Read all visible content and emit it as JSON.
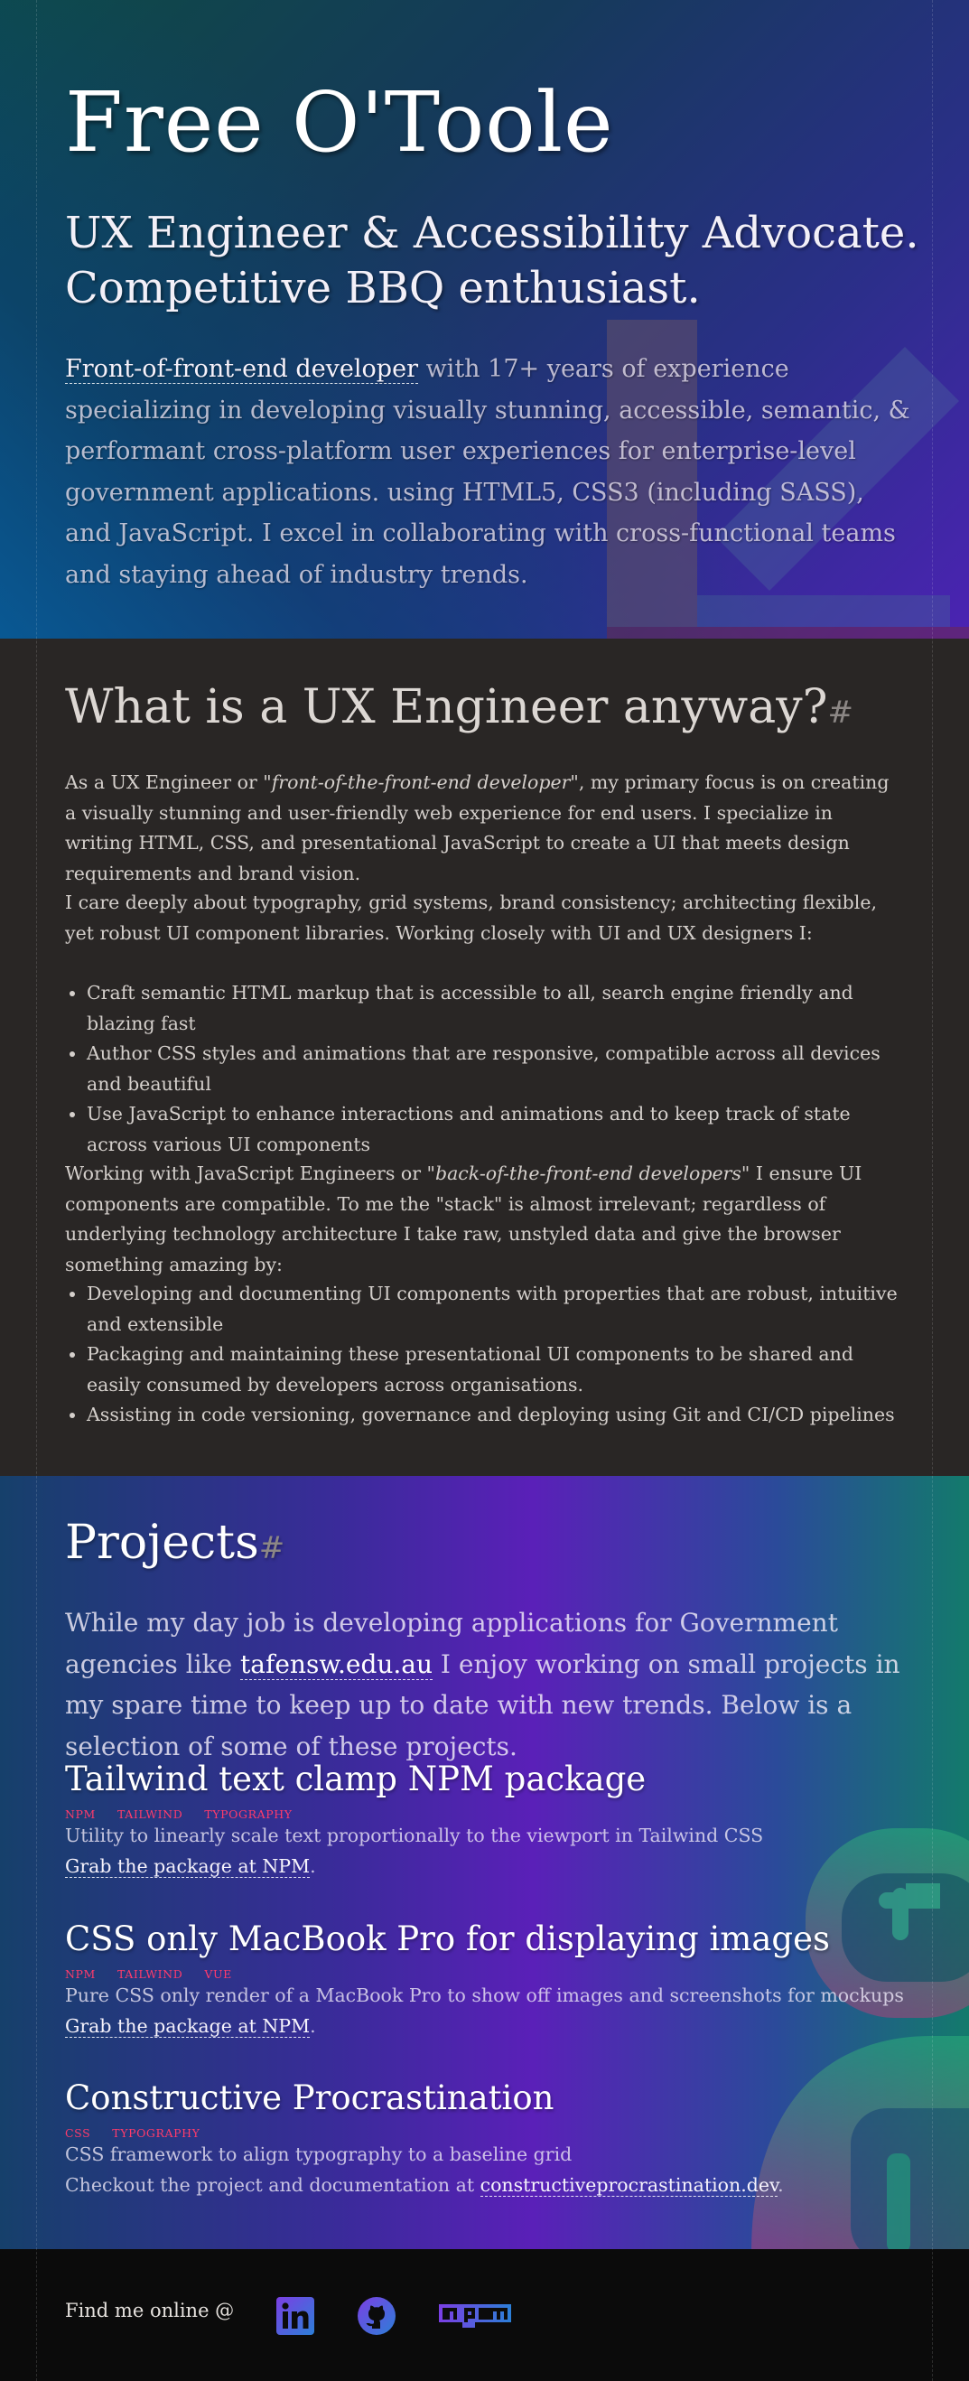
{
  "hero": {
    "name": "Free O'Toole",
    "tagline_line1": "UX Engineer & Accessibility Advocate.",
    "tagline_line2": "Competitive BBQ enthusiast.",
    "intro_link": "Front-of-front-end developer",
    "intro_text": " with 17+ years of experience specializing in developing visually stunning, accessible, semantic, & performant cross-platform user experiences for enterprise-level government applications. using HTML5, CSS3 (including SASS), and JavaScript. I excel in collaborating with cross-functional teams and staying ahead of industry trends."
  },
  "about": {
    "heading": "What is a UX Engineer anyway?",
    "hash": "#",
    "p1_before": "As a UX Engineer or ",
    "p1_em": "\"front-of-the-front-end developer\"",
    "p1_after": ", my primary focus is on creating a visually stunning and user-friendly web experience for end users. I specialize in writing HTML, CSS, and presentational JavaScript to create a UI that meets design requirements and brand vision.",
    "p2": "I care deeply about typography, grid systems, brand consistency; architecting flexible, yet robust UI component libraries. Working closely with UI and UX designers I:",
    "list1": [
      "Craft semantic HTML markup that is accessible to all, search engine friendly and blazing fast",
      "Author CSS styles and animations that are responsive, compatible across all devices and beautiful",
      "Use JavaScript to enhance interactions and animations and to keep track of state across various UI components"
    ],
    "p3_before": "Working with JavaScript Engineers or ",
    "p3_em": "\"back-of-the-front-end developers\"",
    "p3_after": " I ensure UI components are compatible. To me the \"stack\" is almost irrelevant; regardless of underlying technology architecture I take raw, unstyled data and give the browser something amazing by:",
    "list2": [
      "Developing and documenting UI components with properties that are robust, intuitive and extensible",
      "Packaging and maintaining these presentational UI components to be shared and easily consumed by developers across organisations.",
      "Assisting in code versioning, governance and deploying using Git and CI/CD pipelines"
    ]
  },
  "projects": {
    "heading": "Projects",
    "hash": "#",
    "intro_before": "While my day job is developing applications for Government agencies like ",
    "intro_link": "tafensw.edu.au",
    "intro_after": " I enjoy working on small projects in my spare time to keep up to date with new trends. Below is a selection of some of these projects.",
    "items": [
      {
        "title": "Tailwind text clamp NPM package",
        "tags": [
          "NPM",
          "TAILWIND",
          "TYPOGRAPHY"
        ],
        "desc": "Utility to linearly scale text proportionally to the viewport in Tailwind CSS",
        "link_before": "",
        "link": "Grab the package at NPM",
        "link_after": "."
      },
      {
        "title": "CSS only MacBook Pro for displaying images",
        "tags": [
          "NPM",
          "TAILWIND",
          "VUE"
        ],
        "desc": "Pure CSS only render of a MacBook Pro to show off images and screenshots for mockups",
        "link_before": "",
        "link": "Grab the package at NPM",
        "link_after": "."
      },
      {
        "title": "Constructive Procrastination",
        "tags": [
          "CSS",
          "TYPOGRAPHY"
        ],
        "desc": "CSS framework to align typography to a baseline grid",
        "link_before": "Checkout the project and documentation at ",
        "link": "constructiveprocrastination.dev",
        "link_after": "."
      }
    ]
  },
  "footer": {
    "label": "Find me online @",
    "icons": [
      "linkedin-icon",
      "github-icon",
      "npm-icon"
    ]
  },
  "colors": {
    "about_bg": "#292625",
    "footer_bg": "#0b0b0b",
    "tag": "#ff3b6b"
  }
}
